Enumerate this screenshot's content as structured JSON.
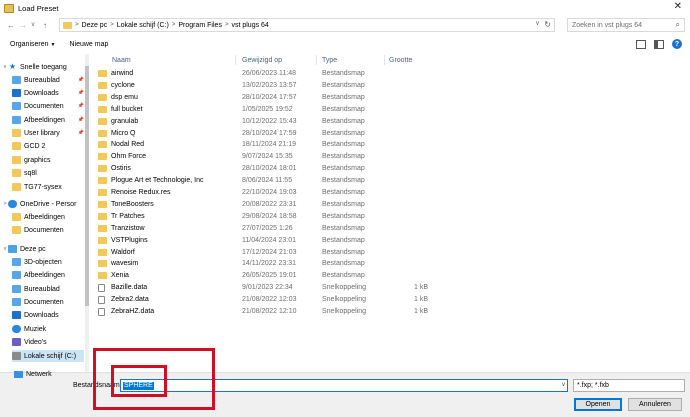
{
  "window": {
    "title": "Load Preset",
    "close_glyph": "✕"
  },
  "address": {
    "crumbs": [
      "Deze pc",
      "Lokale schijf (C:)",
      "Program Files",
      "vst plugs 64"
    ],
    "search_placeholder": "Zoeken in vst plugs 64"
  },
  "toolbar": {
    "organize": "Organiseren",
    "new_folder": "Nieuwe map"
  },
  "sidebar": {
    "items": [
      {
        "label": "Snelle toegang",
        "icon": "star-icon",
        "chev": "v",
        "pinned": false
      },
      {
        "label": "Bureaublad",
        "icon": "desktop-icon",
        "pinned": true
      },
      {
        "label": "Downloads",
        "icon": "download-icon",
        "pinned": true
      },
      {
        "label": "Documenten",
        "icon": "documents-icon",
        "pinned": true
      },
      {
        "label": "Afbeeldingen",
        "icon": "pictures-icon",
        "pinned": true
      },
      {
        "label": "User library",
        "icon": "folder-icon",
        "pinned": true
      },
      {
        "label": "GCD 2",
        "icon": "folder-icon",
        "pinned": false
      },
      {
        "label": "graphics",
        "icon": "folder-icon",
        "pinned": false
      },
      {
        "label": "sq8l",
        "icon": "folder-icon",
        "pinned": false
      },
      {
        "label": "TG77-sysex",
        "icon": "folder-icon",
        "pinned": false
      },
      {
        "label": "OneDrive - Persor",
        "icon": "onedrive-icon",
        "chev": ">",
        "pinned": false
      },
      {
        "label": "Afbeeldingen",
        "icon": "folder-icon",
        "pinned": false
      },
      {
        "label": "Documenten",
        "icon": "folder-icon",
        "pinned": false
      },
      {
        "label": "Deze pc",
        "icon": "pc-icon",
        "chev": "v",
        "pinned": false
      },
      {
        "label": "3D-objecten",
        "icon": "3d-objects-icon",
        "pinned": false
      },
      {
        "label": "Afbeeldingen",
        "icon": "pictures-icon",
        "pinned": false
      },
      {
        "label": "Bureaublad",
        "icon": "desktop-icon",
        "pinned": false
      },
      {
        "label": "Documenten",
        "icon": "documents-icon",
        "pinned": false
      },
      {
        "label": "Downloads",
        "icon": "download-icon",
        "pinned": false
      },
      {
        "label": "Muziek",
        "icon": "music-icon",
        "pinned": false
      },
      {
        "label": "Video's",
        "icon": "video-icon",
        "pinned": false
      },
      {
        "label": "Lokale schijf (C:)",
        "icon": "drive-icon",
        "pinned": false,
        "selected": true
      }
    ],
    "network": "Netwerk"
  },
  "columns": {
    "name": "Naam",
    "date": "Gewijzigd op",
    "type": "Type",
    "size": "Grootte"
  },
  "files": [
    {
      "name": "airwind",
      "date": "26/06/2023 11:48",
      "type": "Bestandsmap",
      "size": "",
      "kind": "folder"
    },
    {
      "name": "cyclone",
      "date": "13/02/2023 13:57",
      "type": "Bestandsmap",
      "size": "",
      "kind": "folder"
    },
    {
      "name": "dsp emu",
      "date": "28/10/2024 17:57",
      "type": "Bestandsmap",
      "size": "",
      "kind": "folder"
    },
    {
      "name": "full bucket",
      "date": "1/05/2025 19:52",
      "type": "Bestandsmap",
      "size": "",
      "kind": "folder"
    },
    {
      "name": "granulab",
      "date": "10/12/2022 15:43",
      "type": "Bestandsmap",
      "size": "",
      "kind": "folder"
    },
    {
      "name": "Micro Q",
      "date": "28/10/2024 17:59",
      "type": "Bestandsmap",
      "size": "",
      "kind": "folder"
    },
    {
      "name": "Nodal Red",
      "date": "18/11/2024 21:19",
      "type": "Bestandsmap",
      "size": "",
      "kind": "folder"
    },
    {
      "name": "Ohm Force",
      "date": "9/07/2024 15:35",
      "type": "Bestandsmap",
      "size": "",
      "kind": "folder"
    },
    {
      "name": "Ostiris",
      "date": "28/10/2024 18:01",
      "type": "Bestandsmap",
      "size": "",
      "kind": "folder"
    },
    {
      "name": "Plogue Art et Technologie, Inc",
      "date": "8/06/2024 11:55",
      "type": "Bestandsmap",
      "size": "",
      "kind": "folder"
    },
    {
      "name": "Renoise Redux.res",
      "date": "22/10/2024 19:03",
      "type": "Bestandsmap",
      "size": "",
      "kind": "folder"
    },
    {
      "name": "ToneBoosters",
      "date": "20/08/2022 23:31",
      "type": "Bestandsmap",
      "size": "",
      "kind": "folder"
    },
    {
      "name": "Tr Patches",
      "date": "29/08/2024 18:58",
      "type": "Bestandsmap",
      "size": "",
      "kind": "folder"
    },
    {
      "name": "Tranzistow",
      "date": "27/07/2025 1:26",
      "type": "Bestandsmap",
      "size": "",
      "kind": "folder"
    },
    {
      "name": "VSTPlugins",
      "date": "11/04/2024 23:01",
      "type": "Bestandsmap",
      "size": "",
      "kind": "folder"
    },
    {
      "name": "Waldorf",
      "date": "17/12/2024 21:03",
      "type": "Bestandsmap",
      "size": "",
      "kind": "folder"
    },
    {
      "name": "wavesim",
      "date": "14/11/2022 23:31",
      "type": "Bestandsmap",
      "size": "",
      "kind": "folder"
    },
    {
      "name": "Xenia",
      "date": "26/05/2025 19:01",
      "type": "Bestandsmap",
      "size": "",
      "kind": "folder"
    },
    {
      "name": "Bazille.data",
      "date": "9/01/2023 22:34",
      "type": "Snelkoppeling",
      "size": "1 kB",
      "kind": "file"
    },
    {
      "name": "Zebra2.data",
      "date": "21/08/2022 12:03",
      "type": "Snelkoppeling",
      "size": "1 kB",
      "kind": "file"
    },
    {
      "name": "ZebraHZ.data",
      "date": "21/08/2022 12:10",
      "type": "Snelkoppeling",
      "size": "1 kB",
      "kind": "file"
    }
  ],
  "footer": {
    "filename_label": "Bestandsnaam:",
    "filename_value": "SPHERE",
    "filetype": "*.fxp; *.fxb",
    "open": "Openen",
    "cancel": "Annuleren"
  },
  "colors": {
    "accent": "#0078d7",
    "annotation": "#d10f24",
    "folder": "#f1c85d"
  }
}
